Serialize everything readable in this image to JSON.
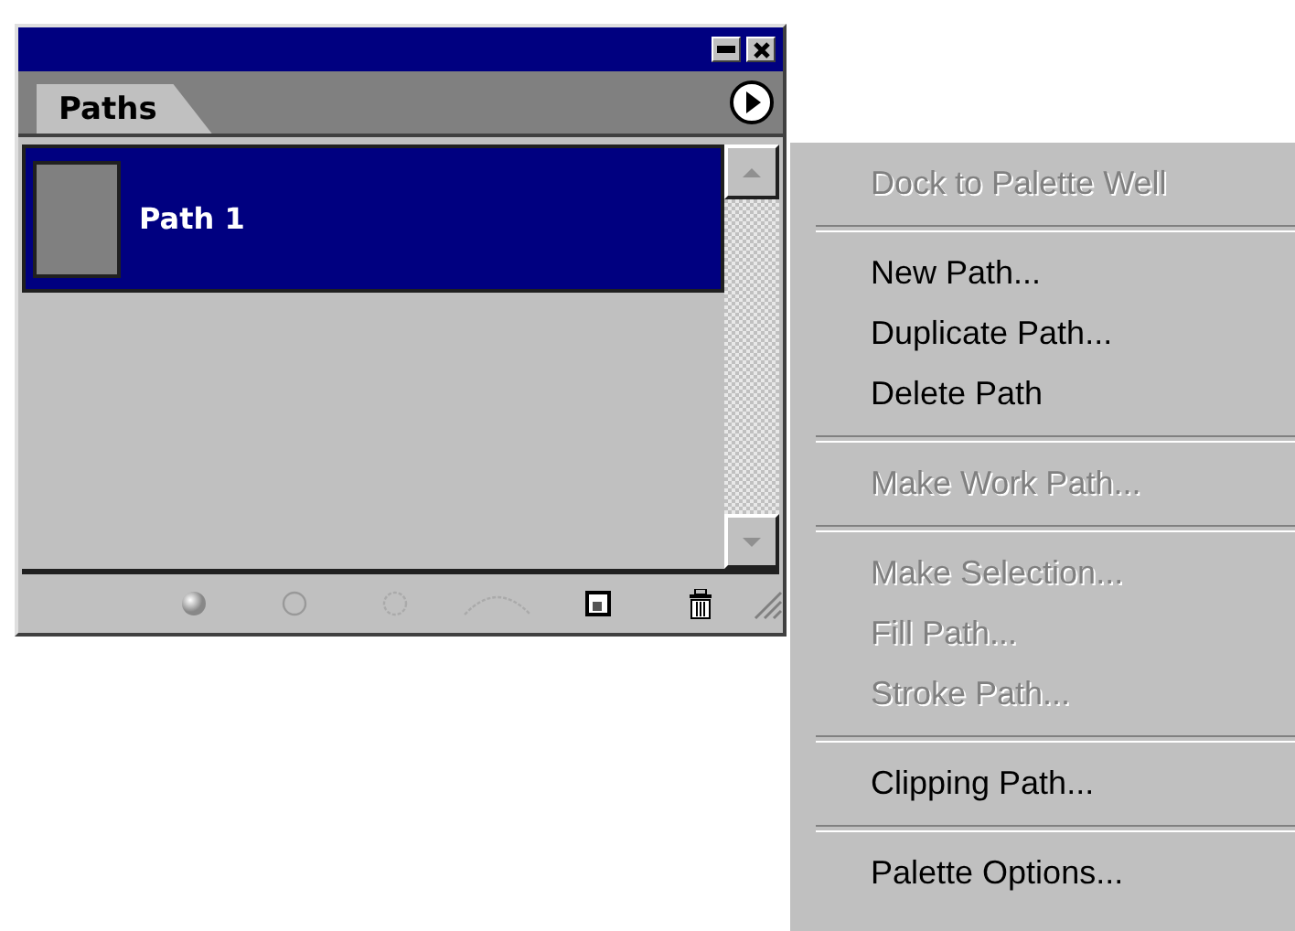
{
  "palette": {
    "tabs": [
      {
        "label": "Paths",
        "selected": true
      }
    ],
    "paths": [
      {
        "name": "Path 1",
        "selected": true
      }
    ]
  },
  "menu": {
    "items": [
      {
        "kind": "item",
        "label": "Dock to Palette Well",
        "disabled": true
      },
      {
        "kind": "separator"
      },
      {
        "kind": "item",
        "label": "New Path...",
        "disabled": false
      },
      {
        "kind": "item",
        "label": "Duplicate Path...",
        "disabled": false
      },
      {
        "kind": "item",
        "label": "Delete Path",
        "disabled": false
      },
      {
        "kind": "separator"
      },
      {
        "kind": "item",
        "label": "Make Work Path...",
        "disabled": true
      },
      {
        "kind": "separator"
      },
      {
        "kind": "item",
        "label": "Make Selection...",
        "disabled": true
      },
      {
        "kind": "item",
        "label": "Fill Path...",
        "disabled": true
      },
      {
        "kind": "item",
        "label": "Stroke Path...",
        "disabled": true
      },
      {
        "kind": "separator"
      },
      {
        "kind": "item",
        "label": "Clipping Path...",
        "disabled": false
      },
      {
        "kind": "separator"
      },
      {
        "kind": "item",
        "label": "Palette Options...",
        "disabled": false
      }
    ]
  }
}
